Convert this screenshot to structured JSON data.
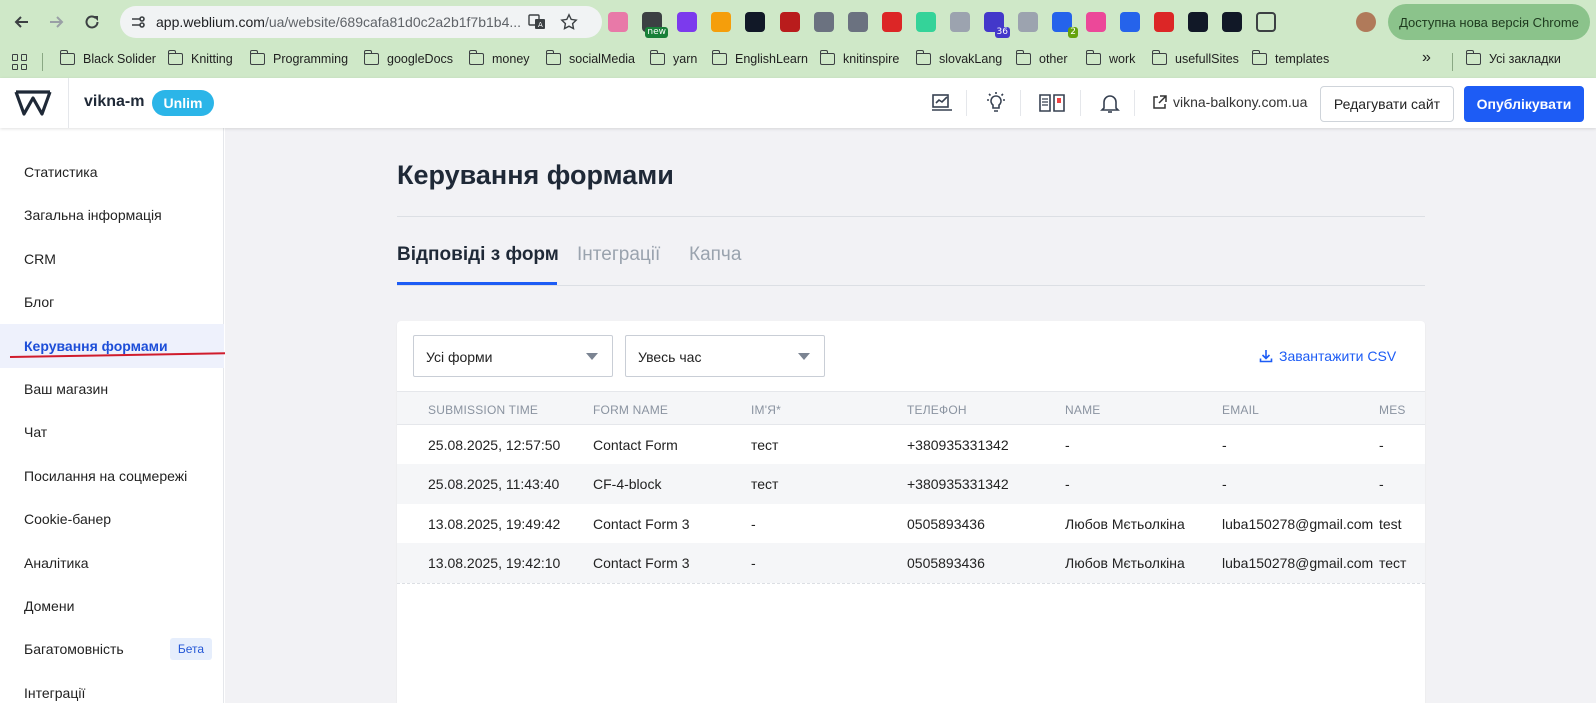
{
  "browser": {
    "url_host": "app.weblium.com",
    "url_path": "/ua/website/689cafa81d0c2a2b1f7b1b4...",
    "update_label": "Доступна нова версія Chrome",
    "extensions": [
      {
        "name": "pink-square-extension-icon",
        "color": "#e879a8",
        "badge": ""
      },
      {
        "name": "new-extension-icon",
        "color": "#3c4043",
        "badge": "new",
        "badge_color": "#188038"
      },
      {
        "name": "color-wheel-extension-icon",
        "color": "#7c3aed",
        "badge": ""
      },
      {
        "name": "orange-target-extension-icon",
        "color": "#f59e0b",
        "badge": ""
      },
      {
        "name": "react-extension-icon",
        "color": "#111827",
        "badge": ""
      },
      {
        "name": "sitemap-extension-icon",
        "color": "#b91c1c",
        "badge": ""
      },
      {
        "name": "camera-extension-icon",
        "color": "#6b7280",
        "badge": ""
      },
      {
        "name": "check-circle-extension-icon",
        "color": "#6b7280",
        "badge": ""
      },
      {
        "name": "two-extension-icon",
        "color": "#dc2626",
        "badge": ""
      },
      {
        "name": "flower-extension-icon",
        "color": "#34d399",
        "badge": ""
      },
      {
        "name": "compass-extension-icon",
        "color": "#9ca3af",
        "badge": ""
      },
      {
        "name": "graduation-extension-icon",
        "color": "#4338ca",
        "badge": "36",
        "badge_color": "#4338ca"
      },
      {
        "name": "grid-extension-icon",
        "color": "#9ca3af",
        "badge": ""
      },
      {
        "name": "code-extension-icon",
        "color": "#2563eb",
        "badge": "2",
        "badge_color": "#65a30d"
      },
      {
        "name": "rainbow-extension-icon",
        "color": "#ec4899",
        "badge": ""
      },
      {
        "name": "tag-extension-icon",
        "color": "#2563eb",
        "badge": ""
      },
      {
        "name": "flag-extension-icon",
        "color": "#dc2626",
        "badge": ""
      },
      {
        "name": "soccer-extension-icon",
        "color": "#111827",
        "badge": ""
      },
      {
        "name": "black-red-extension-icon",
        "color": "#111827",
        "badge": ""
      },
      {
        "name": "puzzle-extension-icon",
        "color": "#3c4043",
        "badge": ""
      }
    ]
  },
  "bookmarks": {
    "items": [
      "Black Solider",
      "Knitting",
      "Programming",
      "googleDocs",
      "money",
      "socialMedia",
      "yarn",
      "EnglishLearn",
      "knitinspire",
      "slovakLang",
      "other",
      "work",
      "usefullSites",
      "templates"
    ],
    "more": "»",
    "all_bookmarks": "Усі закладки"
  },
  "header": {
    "site_name": "vikna-m",
    "plan": "Unlim",
    "domain": "vikna-balkony.com.ua",
    "edit_label": "Редагувати сайт",
    "publish_label": "Опублікувати"
  },
  "sidebar": {
    "items": [
      {
        "label": "Статистика"
      },
      {
        "label": "Загальна інформація"
      },
      {
        "label": "CRM"
      },
      {
        "label": "Блог"
      },
      {
        "label": "Керування формами",
        "active": true
      },
      {
        "label": "Ваш магазин"
      },
      {
        "label": "Чат"
      },
      {
        "label": "Посилання на соцмережі"
      },
      {
        "label": "Cookie-банер"
      },
      {
        "label": "Аналітика"
      },
      {
        "label": "Домени"
      },
      {
        "label": "Багатомовність",
        "badge": "Бета"
      },
      {
        "label": "Інтеграції"
      }
    ]
  },
  "main": {
    "title": "Керування формами",
    "tabs": [
      {
        "label": "Відповіді з форм",
        "active": true
      },
      {
        "label": "Інтеграції"
      },
      {
        "label": "Капча"
      }
    ],
    "filters": {
      "form": "Усі форми",
      "period": "Увесь час"
    },
    "csv_label": "Завантажити CSV",
    "table": {
      "columns": [
        "SUBMISSION TIME",
        "FORM NAME",
        "ІМ'Я*",
        "ТЕЛЕФОН",
        "NAME",
        "EMAIL",
        "MES"
      ],
      "rows": [
        [
          "25.08.2025, 12:57:50",
          "Contact Form",
          "тест",
          "+380935331342",
          "-",
          "-",
          "-"
        ],
        [
          "25.08.2025, 11:43:40",
          "CF-4-block",
          "тест",
          "+380935331342",
          "-",
          "-",
          "-"
        ],
        [
          "13.08.2025, 19:49:42",
          "Contact Form 3",
          "-",
          "0505893436",
          "Любов Мєтьолкіна",
          "luba150278@gmail.com",
          "test"
        ],
        [
          "13.08.2025, 19:42:10",
          "Contact Form 3",
          "-",
          "0505893436",
          "Любов Мєтьолкіна",
          "luba150278@gmail.com",
          "тест"
        ]
      ]
    }
  },
  "colors": {
    "brand_blue": "#1d5cf5",
    "plan_badge": "#2bb5e8",
    "annotation_red": "#d01c2c",
    "chrome_green": "#cfe8c8"
  }
}
